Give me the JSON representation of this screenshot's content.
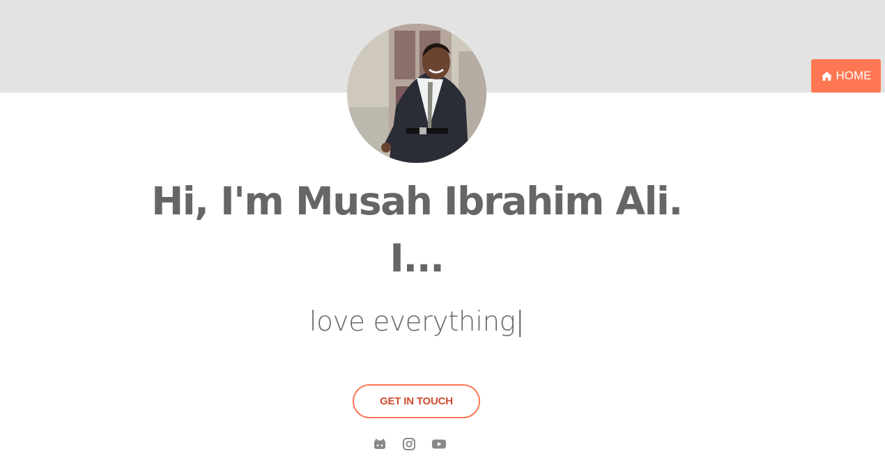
{
  "nav": {
    "home_label": "HOME"
  },
  "hero": {
    "headline_line1": "Hi, I'm Musah Ibrahim Ali.",
    "headline_line2": "I...",
    "typed_text": "love everything",
    "cursor": "|",
    "cta_label": "GET IN TOUCH"
  },
  "socials": [
    {
      "icon": "github-icon"
    },
    {
      "icon": "instagram-icon"
    },
    {
      "icon": "youtube-icon"
    }
  ],
  "colors": {
    "accent": "#ff7752",
    "cta_text": "#cf4d30",
    "band": "#e3e3e3",
    "heading": "#666666"
  }
}
